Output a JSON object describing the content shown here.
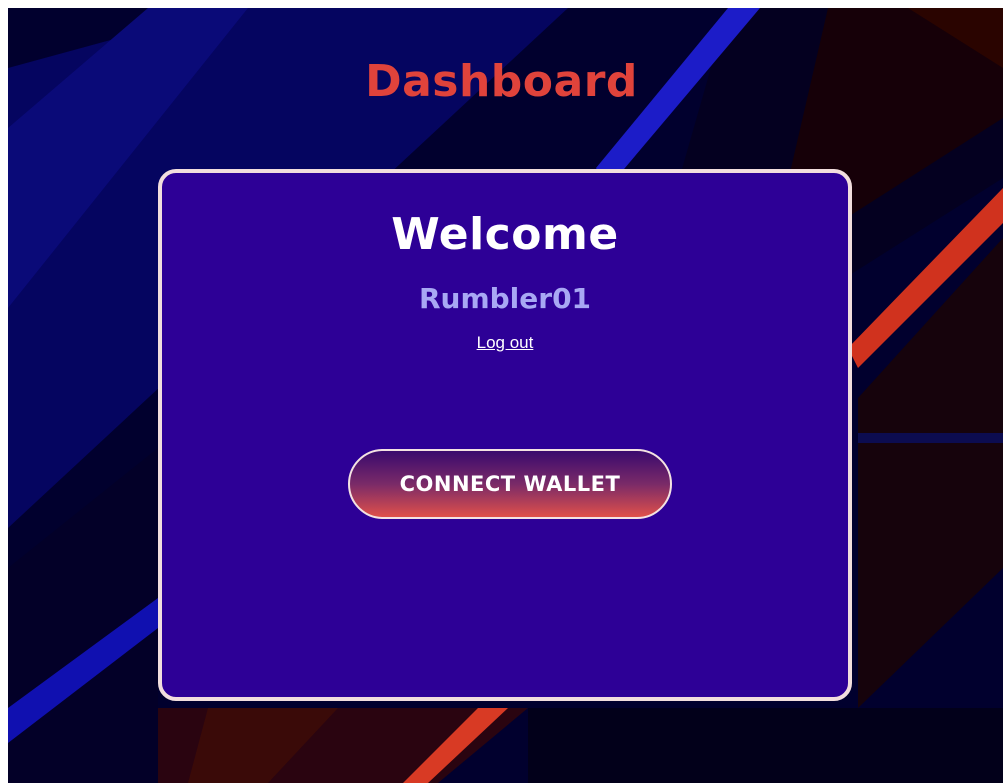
{
  "header": {
    "title": "Dashboard"
  },
  "card": {
    "welcome": "Welcome",
    "username": "Rumbler01",
    "logout_label": "Log out",
    "connect_wallet_label": "CONNECT WALLET"
  },
  "colors": {
    "background": "#01002e",
    "title": "#e0433b",
    "card": "#2d0096",
    "card_border": "#f2dede",
    "username": "#a8a8f4",
    "button_top": "#3a0a6e",
    "button_bottom": "#e0504a"
  }
}
